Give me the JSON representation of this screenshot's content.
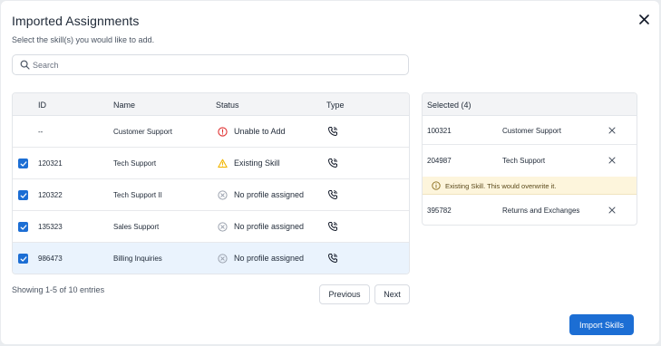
{
  "dialog": {
    "title": "Imported Assignments",
    "subtitle": "Select the skill(s) you would like to add."
  },
  "search": {
    "placeholder": "Search",
    "value": ""
  },
  "table": {
    "headers": {
      "id": "ID",
      "name": "Name",
      "status": "Status",
      "type": "Type"
    },
    "rows": [
      {
        "id": "--",
        "name": "Customer Support",
        "status": "Unable to Add",
        "status_icon": "error-circle-icon",
        "checked": false,
        "type_icon": "phone-icon"
      },
      {
        "id": "120321",
        "name": "Tech Support",
        "status": "Existing Skill",
        "status_icon": "warning-triangle-icon",
        "checked": true,
        "type_icon": "phone-icon"
      },
      {
        "id": "120322",
        "name": "Tech Support II",
        "status": "No profile assigned",
        "status_icon": "x-circle-icon",
        "checked": true,
        "type_icon": "phone-icon"
      },
      {
        "id": "135323",
        "name": "Sales Support",
        "status": "No profile assigned",
        "status_icon": "x-circle-icon",
        "checked": true,
        "type_icon": "phone-icon"
      },
      {
        "id": "986473",
        "name": "Billing Inquiries",
        "status": "No profile assigned",
        "status_icon": "x-circle-icon",
        "checked": true,
        "type_icon": "phone-icon",
        "highlighted": true
      }
    ]
  },
  "pagination": {
    "info": "Showing 1-5 of 10 entries",
    "prev_label": "Previous",
    "next_label": "Next"
  },
  "selected": {
    "header": "Selected (4)",
    "items": [
      {
        "id": "100321",
        "name": "Customer Support"
      },
      {
        "id": "204987",
        "name": "Tech Support"
      },
      {
        "id": "395782",
        "name": "Returns and Exchanges"
      }
    ],
    "warning": "Existing Skill. This would overwrite it."
  },
  "actions": {
    "import_label": "Import Skills"
  },
  "colors": {
    "accent": "#1c6ed4",
    "error": "#e03131",
    "warning": "#f2b705",
    "muted": "#9ca3af",
    "warning_bg": "#fdf5dc"
  }
}
